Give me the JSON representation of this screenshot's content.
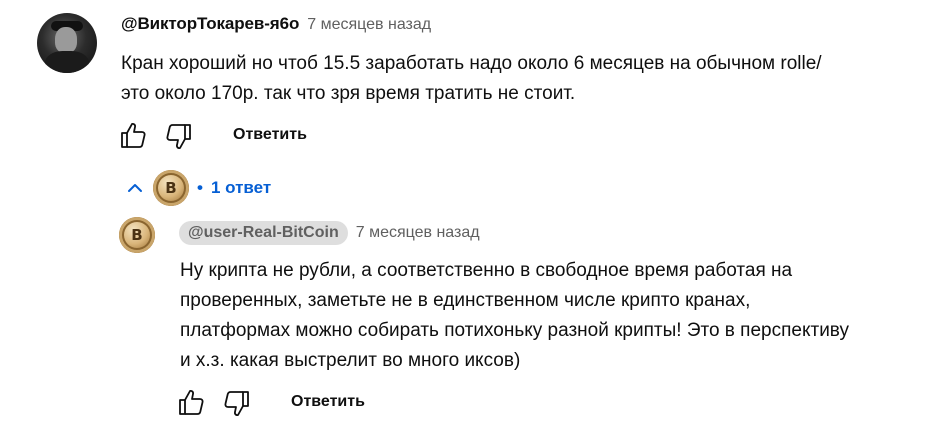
{
  "comment": {
    "author": "@ВикторТокарев-я6о",
    "time": "7 месяцев назад",
    "lines": [
      "Кран хороший но чтоб 15.5 заработать надо около 6 месяцев на обычном rolle/",
      "это около 170р. так что зря время тратить не стоит."
    ],
    "reply_label": "Ответить",
    "like_icon": "thumb-up-icon",
    "dislike_icon": "thumb-down-icon"
  },
  "replies_toggle": {
    "icon": "chevron-up-icon",
    "dot": "•",
    "count_label": "1 ответ"
  },
  "reply": {
    "author": "@user-Real-BitCoin",
    "time": "7 месяцев назад",
    "lines": [
      "Ну крипта не рубли, а соответственно в свободное время работая на",
      "проверенных, заметьте не в единственном числе крипто кранах,",
      "платформах можно собирать потихоньку разной крипты! Это в перспективу",
      "и х.з. какая выстрелит во много иксов)"
    ],
    "reply_label": "Ответить",
    "avatar_glyph": "B"
  },
  "colors": {
    "link_blue": "#065fd4",
    "muted": "#606060",
    "chip_bg": "#dedede"
  }
}
